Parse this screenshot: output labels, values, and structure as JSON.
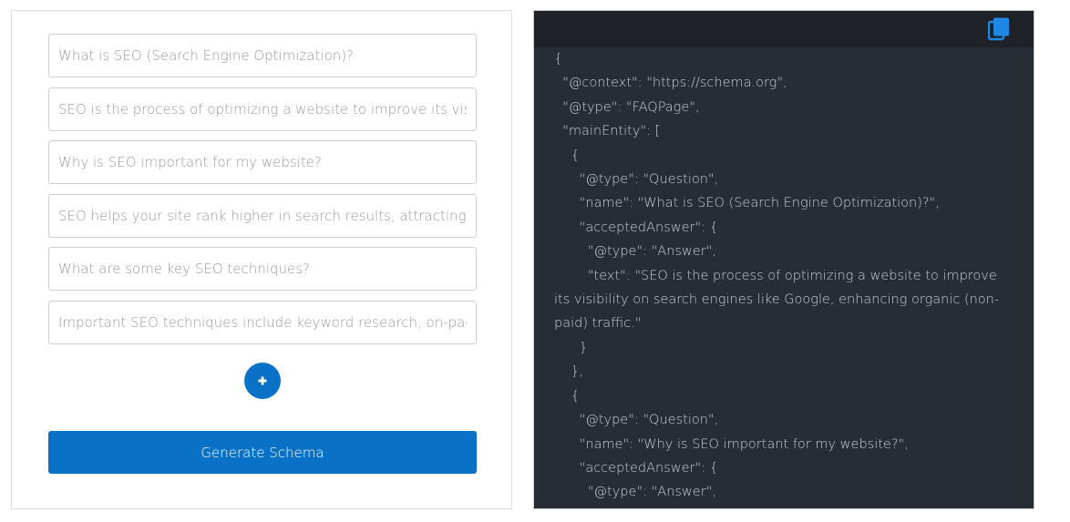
{
  "form": {
    "fields": [
      {
        "placeholder": "What is SEO (Search Engine Optimization)?"
      },
      {
        "placeholder": "SEO is the process of optimizing a website to improve its visibili"
      },
      {
        "placeholder": "Why is SEO important for my website?"
      },
      {
        "placeholder": "SEO helps your site rank higher in search results, attracting mor"
      },
      {
        "placeholder": "What are some key SEO techniques?"
      },
      {
        "placeholder": "Important SEO techniques include keyword research, on-page o"
      }
    ],
    "add_icon": "plus-icon",
    "generate_label": "Generate Schema"
  },
  "output": {
    "copy_icon": "copy-icon",
    "code": "{\n  \"@context\": \"https://schema.org\",\n  \"@type\": \"FAQPage\",\n  \"mainEntity\": [\n    {\n      \"@type\": \"Question\",\n      \"name\": \"What is SEO (Search Engine Optimization)?\",\n      \"acceptedAnswer\": {\n        \"@type\": \"Answer\",\n        \"text\": \"SEO is the process of optimizing a website to improve its visibility on search engines like Google, enhancing organic (non-paid) traffic.\"\n      }\n    },\n    {\n      \"@type\": \"Question\",\n      \"name\": \"Why is SEO important for my website?\",\n      \"acceptedAnswer\": {\n        \"@type\": \"Answer\","
  },
  "colors": {
    "accent": "#0a72c6",
    "code_background": "#282c34",
    "code_header": "#1f2227",
    "code_text": "#c9ccd3"
  }
}
